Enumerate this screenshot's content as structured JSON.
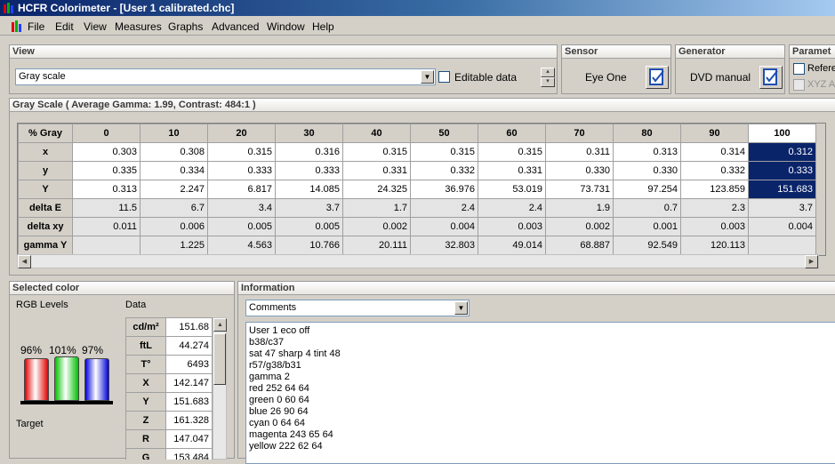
{
  "window": {
    "title": "HCFR Colorimeter - [User 1 calibrated.chc]"
  },
  "menu": [
    "File",
    "Edit",
    "View",
    "Measures",
    "Graphs",
    "Advanced",
    "Window",
    "Help"
  ],
  "view_panel": {
    "header": "View",
    "mode_value": "Gray scale",
    "editable_label": "Editable data"
  },
  "sensor_panel": {
    "header": "Sensor",
    "value": "Eye One"
  },
  "generator_panel": {
    "header": "Generator",
    "value": "DVD manual"
  },
  "params_panel": {
    "header": "Paramet",
    "opt1": "Refere",
    "opt2": "XYZ A"
  },
  "grayscale": {
    "header": "Gray Scale ( Average Gamma: 1.99, Contrast: 484:1 )",
    "corner": "% Gray",
    "columns": [
      "0",
      "10",
      "20",
      "30",
      "40",
      "50",
      "60",
      "70",
      "80",
      "90",
      "100"
    ],
    "rows": [
      {
        "label": "x",
        "values": [
          "0.303",
          "0.308",
          "0.315",
          "0.316",
          "0.315",
          "0.315",
          "0.315",
          "0.311",
          "0.313",
          "0.314",
          "0.312"
        ]
      },
      {
        "label": "y",
        "values": [
          "0.335",
          "0.334",
          "0.333",
          "0.333",
          "0.331",
          "0.332",
          "0.331",
          "0.330",
          "0.330",
          "0.332",
          "0.333"
        ]
      },
      {
        "label": "Y",
        "values": [
          "0.313",
          "2.247",
          "6.817",
          "14.085",
          "24.325",
          "36.976",
          "53.019",
          "73.731",
          "97.254",
          "123.859",
          "151.683"
        ]
      },
      {
        "label": "delta E",
        "values": [
          "11.5",
          "6.7",
          "3.4",
          "3.7",
          "1.7",
          "2.4",
          "2.4",
          "1.9",
          "0.7",
          "2.3",
          "3.7"
        ]
      },
      {
        "label": "delta xy",
        "values": [
          "0.011",
          "0.006",
          "0.005",
          "0.005",
          "0.002",
          "0.004",
          "0.003",
          "0.002",
          "0.001",
          "0.003",
          "0.004"
        ]
      },
      {
        "label": "gamma Y",
        "values": [
          "",
          "1.225",
          "4.563",
          "10.766",
          "20.111",
          "32.803",
          "49.014",
          "68.887",
          "92.549",
          "120.113",
          ""
        ]
      }
    ]
  },
  "selected_color": {
    "header": "Selected color",
    "rgb_label": "RGB Levels",
    "data_label": "Data",
    "target_label": "Target",
    "levels": [
      {
        "name": "red",
        "percent_text": "96%",
        "level": 0.96,
        "color": "#e00000"
      },
      {
        "name": "green",
        "percent_text": "101%",
        "level": 1.01,
        "color": "#00c000"
      },
      {
        "name": "blue",
        "percent_text": "97%",
        "level": 0.97,
        "color": "#0000d8"
      }
    ],
    "data": [
      {
        "k": "cd/m²",
        "v": "151.68"
      },
      {
        "k": "ftL",
        "v": "44.274"
      },
      {
        "k": "T°",
        "v": "6493"
      },
      {
        "k": "X",
        "v": "142.147"
      },
      {
        "k": "Y",
        "v": "151.683"
      },
      {
        "k": "Z",
        "v": "161.328"
      },
      {
        "k": "R",
        "v": "147.047"
      },
      {
        "k": "G",
        "v": "153.484"
      }
    ]
  },
  "information": {
    "header": "Information",
    "combo_value": "Comments",
    "lines": [
      "User 1 eco off",
      "b38/c37",
      "sat 47 sharp 4 tint 48",
      "r57/g38/b31",
      "gamma 2",
      "red 252 64 64",
      "green 0 60 64",
      "blue 26 90 64",
      "cyan 0 64 64",
      "magenta 243 65 64",
      "yellow 222 62 64"
    ]
  }
}
